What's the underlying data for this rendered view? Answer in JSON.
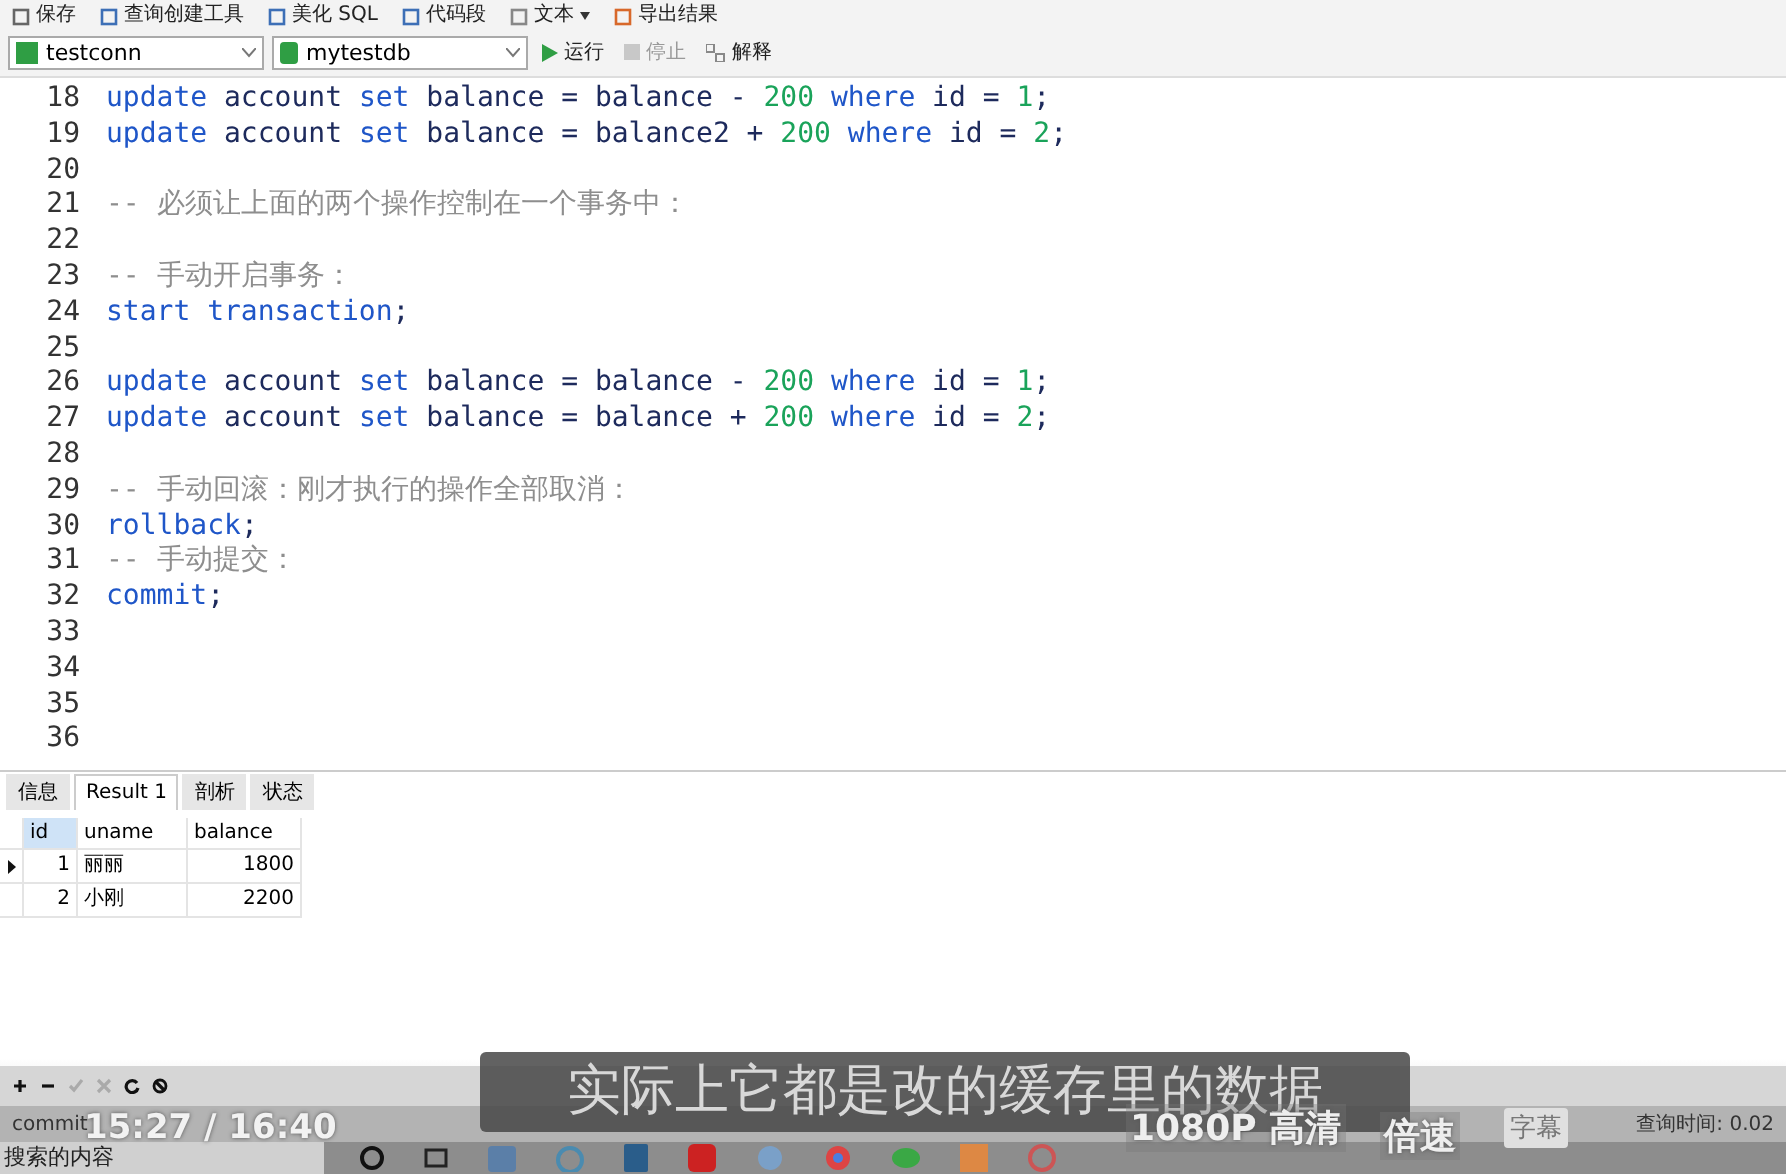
{
  "toolbar": [
    {
      "label": "保存",
      "dropdown": false
    },
    {
      "label": "查询创建工具",
      "dropdown": false
    },
    {
      "label": "美化 SQL",
      "dropdown": false
    },
    {
      "label": "代码段",
      "dropdown": false
    },
    {
      "label": "文本",
      "dropdown": true
    },
    {
      "label": "导出结果",
      "dropdown": false
    }
  ],
  "connection": {
    "value": "testconn"
  },
  "database": {
    "value": "mytestdb"
  },
  "actions": [
    {
      "label": "运行",
      "kind": "run",
      "disabled": false
    },
    {
      "label": "停止",
      "kind": "stop",
      "disabled": true
    },
    {
      "label": "解释",
      "kind": "explain",
      "disabled": false
    }
  ],
  "editor": {
    "lines": [
      {
        "number": "18",
        "tokens": [
          {
            "kind": "keyword",
            "text": "update"
          },
          {
            "kind": "plain",
            "text": " account "
          },
          {
            "kind": "keyword",
            "text": "set"
          },
          {
            "kind": "plain",
            "text": " balance = balance - "
          },
          {
            "kind": "number",
            "text": "200"
          },
          {
            "kind": "keyword",
            "text": " where"
          },
          {
            "kind": "plain",
            "text": " id = "
          },
          {
            "kind": "number",
            "text": "1"
          },
          {
            "kind": "plain",
            "text": ";"
          }
        ]
      },
      {
        "number": "19",
        "tokens": [
          {
            "kind": "keyword",
            "text": "update"
          },
          {
            "kind": "plain",
            "text": " account "
          },
          {
            "kind": "keyword",
            "text": "set"
          },
          {
            "kind": "plain",
            "text": " balance = balance2 + "
          },
          {
            "kind": "number",
            "text": "200"
          },
          {
            "kind": "keyword",
            "text": " where"
          },
          {
            "kind": "plain",
            "text": " id = "
          },
          {
            "kind": "number",
            "text": "2"
          },
          {
            "kind": "plain",
            "text": ";"
          }
        ]
      },
      {
        "number": "20"
      },
      {
        "number": "21",
        "tokens": [
          {
            "kind": "comment",
            "text": "-- 必须让上面的两个操作控制在一个事务中："
          }
        ]
      },
      {
        "number": "22"
      },
      {
        "number": "23",
        "tokens": [
          {
            "kind": "comment",
            "text": "-- 手动开启事务："
          }
        ]
      },
      {
        "number": "24",
        "tokens": [
          {
            "kind": "keyword",
            "text": "start transaction"
          },
          {
            "kind": "plain",
            "text": ";"
          }
        ]
      },
      {
        "number": "25"
      },
      {
        "number": "26",
        "tokens": [
          {
            "kind": "keyword",
            "text": "update"
          },
          {
            "kind": "plain",
            "text": " account "
          },
          {
            "kind": "keyword",
            "text": "set"
          },
          {
            "kind": "plain",
            "text": " balance = balance - "
          },
          {
            "kind": "number",
            "text": "200"
          },
          {
            "kind": "keyword",
            "text": " where"
          },
          {
            "kind": "plain",
            "text": " id = "
          },
          {
            "kind": "number",
            "text": "1"
          },
          {
            "kind": "plain",
            "text": ";"
          }
        ]
      },
      {
        "number": "27",
        "tokens": [
          {
            "kind": "keyword",
            "text": "update"
          },
          {
            "kind": "plain",
            "text": " account "
          },
          {
            "kind": "keyword",
            "text": "set"
          },
          {
            "kind": "plain",
            "text": " balance = balance + "
          },
          {
            "kind": "number",
            "text": "200"
          },
          {
            "kind": "keyword",
            "text": " where"
          },
          {
            "kind": "plain",
            "text": " id = "
          },
          {
            "kind": "number",
            "text": "2"
          },
          {
            "kind": "plain",
            "text": ";"
          }
        ]
      },
      {
        "number": "28"
      },
      {
        "number": "29",
        "tokens": [
          {
            "kind": "comment",
            "text": "-- 手动回滚：刚才执行的操作全部取消："
          }
        ]
      },
      {
        "number": "30",
        "tokens": [
          {
            "kind": "keyword",
            "text": "rollback"
          },
          {
            "kind": "plain",
            "text": ";"
          }
        ]
      },
      {
        "number": "31",
        "tokens": [
          {
            "kind": "comment",
            "text": "-- 手动提交："
          }
        ]
      },
      {
        "number": "32",
        "tokens": [
          {
            "kind": "keyword",
            "text": "commit"
          },
          {
            "kind": "plain",
            "text": ";"
          }
        ]
      },
      {
        "number": "33"
      },
      {
        "number": "34"
      },
      {
        "number": "35"
      },
      {
        "number": "36"
      }
    ]
  },
  "result_tabs": [
    {
      "label": "信息",
      "selected": false
    },
    {
      "label": "Result 1",
      "selected": true
    },
    {
      "label": "剖析",
      "selected": false
    },
    {
      "label": "状态",
      "selected": false
    }
  ],
  "table": {
    "columns": [
      "id",
      "uname",
      "balance"
    ],
    "rows": [
      {
        "selected": true,
        "cells": [
          "1",
          "丽丽",
          "1800"
        ]
      },
      {
        "selected": false,
        "cells": [
          "2",
          "小刚",
          "2200"
        ]
      }
    ]
  },
  "grid_buttons": [
    {
      "disabled": false
    },
    {
      "disabled": false
    },
    {
      "disabled": true
    },
    {
      "disabled": true
    },
    {
      "disabled": false
    },
    {
      "disabled": false
    }
  ],
  "status_bar": {
    "query": "commit",
    "query_time": "查询时间: 0.02"
  },
  "taskbar": {
    "search_placeholder": "搜索的内容"
  },
  "video_player": {
    "subtitle": "实际上它都是改的缓存里的数据",
    "time": "15:27 / 16:40",
    "quality": "1080P 高清",
    "speed": "倍速",
    "captions": "字幕"
  }
}
